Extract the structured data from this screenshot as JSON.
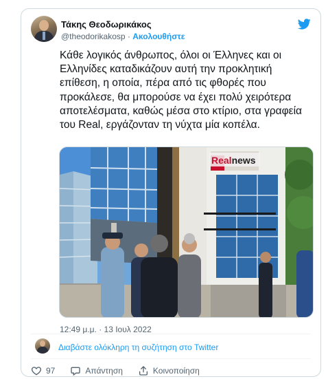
{
  "author": {
    "name": "Τάκης Θεοδωρικάκος",
    "handle": "@theodorikakosp",
    "separator": "·",
    "follow_label": "Ακολουθήστε"
  },
  "tweet": {
    "text": "Κάθε λογικός άνθρωπος, όλοι οι Έλληνες και οι Ελληνίδες καταδικάζουν αυτή την προκλητική επίθεση, η οποία, πέρα από τις φθορές που προκάλεσε, θα μπορούσε να έχει πολύ χειρότερα αποτελέσματα, καθώς μέσα στο κτίριο, στα γραφεία του Real, εργάζονταν τη νύχτα μία κοπέλα.",
    "timestamp": "12:49 μ.μ. · 13 Ιουλ 2022"
  },
  "photo": {
    "sign_real": "Real",
    "sign_news": "news"
  },
  "thread_link": "Διαβάστε ολόκληρη τη συζήτηση στο Twitter",
  "actions": {
    "like_count": "97",
    "reply_label": "Απάντηση",
    "share_label": "Κοινοποίηση"
  },
  "icons": {
    "brand": "twitter-bird-icon",
    "like": "heart-icon",
    "reply": "speech-bubble-icon",
    "share": "share-upload-icon"
  },
  "colors": {
    "accent": "#1d9bf0",
    "text": "#0f1419",
    "muted": "#536471",
    "border": "#cfd9de",
    "sign_red": "#c8102e"
  }
}
